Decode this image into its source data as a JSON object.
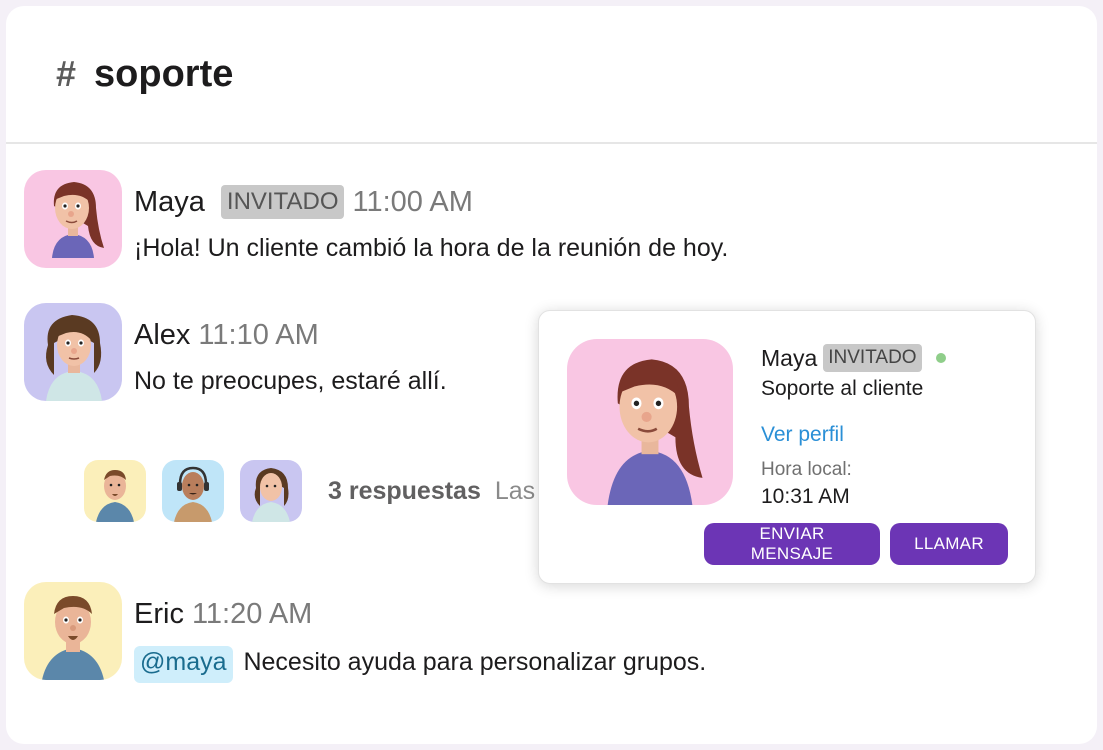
{
  "channel": {
    "hash": "#",
    "name": "soporte"
  },
  "messages": [
    {
      "author": "Maya",
      "badge": "INVITADO",
      "time": "11:00 AM",
      "text": "¡Hola! Un cliente cambió la hora de la reunión de hoy.",
      "avatar_bg": "#f9c6e3"
    },
    {
      "author": "Alex",
      "time": "11:10 AM",
      "text": "No te preocupes, estaré allí.",
      "avatar_bg": "#c9c6f1"
    },
    {
      "author": "Eric",
      "time": "11:20 AM",
      "mention": "@maya",
      "text": " Necesito ayuda para personalizar grupos.",
      "avatar_bg": "#fbefba"
    }
  ],
  "thread": {
    "replies_label": "3 respuestas",
    "last_reply": "Las",
    "avatar_bgs": [
      "#fbefba",
      "#bfe5f8",
      "#c9c6f1"
    ]
  },
  "profile_popup": {
    "name": "Maya",
    "badge": "INVITADO",
    "role": "Soporte al cliente",
    "profile_link": "Ver perfil",
    "local_time_label": "Hora local:",
    "local_time": "10:31 AM",
    "message_button": "ENVIAR MENSAJE",
    "call_button": "LLAMAR",
    "avatar_bg": "#f9c6e3",
    "status_color": "#8fce8a"
  },
  "colors": {
    "accent": "#6c35b5",
    "link": "#2a8fd6",
    "mention_bg": "#cfeefb",
    "badge_bg": "#c8c8c8"
  }
}
